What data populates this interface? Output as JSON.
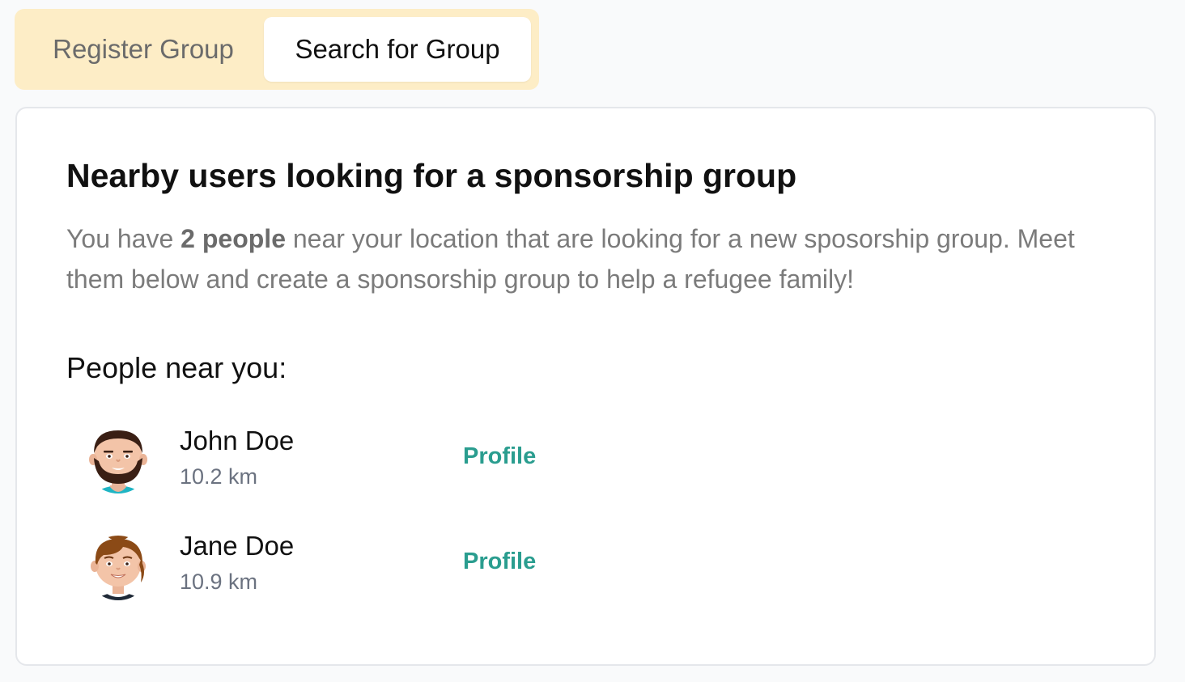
{
  "tabs": [
    {
      "label": "Register Group",
      "active": false
    },
    {
      "label": "Search for Group",
      "active": true
    }
  ],
  "card": {
    "title": "Nearby users looking for a sponsorship group",
    "description": {
      "prefix": "You have ",
      "count": "2 people",
      "suffix": " near your location that are looking for a new sposorship group. Meet them below and create a sponsorship group to help a refugee family!"
    },
    "people_heading": "People near you:"
  },
  "people": [
    {
      "name": "John Doe",
      "distance": "10.2 km",
      "link_label": "Profile",
      "avatar": "male-avatar-icon"
    },
    {
      "name": "Jane Doe",
      "distance": "10.9 km",
      "link_label": "Profile",
      "avatar": "female-avatar-icon"
    }
  ],
  "colors": {
    "tab_bar_background": "#fdedc6",
    "accent_link": "#2a9d8f",
    "page_background": "#f9fafb"
  }
}
